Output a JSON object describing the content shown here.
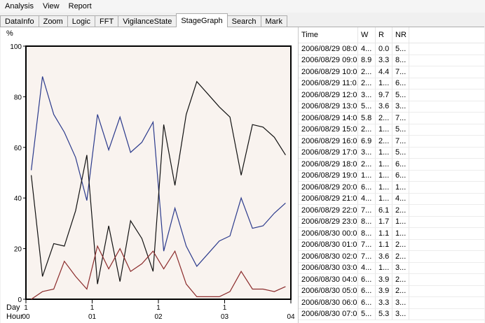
{
  "menu": [
    "Analysis",
    "View",
    "Report"
  ],
  "tabs": [
    {
      "label": "DataInfo",
      "active": false
    },
    {
      "label": "Zoom",
      "active": false
    },
    {
      "label": "Logic",
      "active": false
    },
    {
      "label": "FFT",
      "active": false
    },
    {
      "label": "VigilanceState",
      "active": false
    },
    {
      "label": "StageGraph",
      "active": true
    },
    {
      "label": "Search",
      "active": false
    },
    {
      "label": "Mark",
      "active": false
    }
  ],
  "chart_data": {
    "type": "line",
    "title": "",
    "ylabel": "%",
    "ylim": [
      0,
      100
    ],
    "yticks": [
      0,
      20,
      40,
      60,
      80,
      100
    ],
    "xlim": [
      0,
      4
    ],
    "xrow_labels": [
      "Day",
      "Hour"
    ],
    "xticks": [
      {
        "x": 0,
        "day": "1",
        "hour": "00"
      },
      {
        "x": 1,
        "day": "1",
        "hour": "01"
      },
      {
        "x": 2,
        "day": "1",
        "hour": "02"
      },
      {
        "x": 3,
        "day": "1",
        "hour": "03"
      },
      {
        "x": 4,
        "day": "",
        "hour": "04"
      }
    ],
    "series": [
      {
        "color": "#2b3a8c",
        "points": [
          [
            0.08,
            51
          ],
          [
            0.25,
            88
          ],
          [
            0.42,
            73
          ],
          [
            0.58,
            66
          ],
          [
            0.75,
            56
          ],
          [
            0.92,
            39
          ],
          [
            1.08,
            73
          ],
          [
            1.25,
            59
          ],
          [
            1.42,
            72
          ],
          [
            1.58,
            58
          ],
          [
            1.75,
            62
          ],
          [
            1.92,
            70
          ],
          [
            2.08,
            19
          ],
          [
            2.25,
            36
          ],
          [
            2.42,
            21
          ],
          [
            2.58,
            13
          ],
          [
            2.75,
            18
          ],
          [
            2.92,
            23
          ],
          [
            3.08,
            25
          ],
          [
            3.25,
            40
          ],
          [
            3.42,
            28
          ],
          [
            3.58,
            29
          ],
          [
            3.75,
            34
          ],
          [
            3.92,
            38
          ]
        ]
      },
      {
        "color": "#111111",
        "points": [
          [
            0.08,
            49
          ],
          [
            0.25,
            9
          ],
          [
            0.42,
            22
          ],
          [
            0.58,
            21
          ],
          [
            0.75,
            35
          ],
          [
            0.92,
            57
          ],
          [
            1.08,
            6
          ],
          [
            1.25,
            29
          ],
          [
            1.42,
            7
          ],
          [
            1.58,
            31
          ],
          [
            1.75,
            24
          ],
          [
            1.92,
            11
          ],
          [
            2.08,
            69
          ],
          [
            2.25,
            45
          ],
          [
            2.42,
            73
          ],
          [
            2.58,
            86
          ],
          [
            2.75,
            81
          ],
          [
            2.92,
            76
          ],
          [
            3.08,
            72
          ],
          [
            3.25,
            49
          ],
          [
            3.42,
            69
          ],
          [
            3.58,
            68
          ],
          [
            3.75,
            64
          ],
          [
            3.92,
            57
          ]
        ]
      },
      {
        "color": "#8b2b2b",
        "points": [
          [
            0.08,
            0
          ],
          [
            0.25,
            3
          ],
          [
            0.42,
            4
          ],
          [
            0.58,
            15
          ],
          [
            0.75,
            9
          ],
          [
            0.92,
            4
          ],
          [
            1.08,
            21
          ],
          [
            1.25,
            12
          ],
          [
            1.42,
            20
          ],
          [
            1.58,
            11
          ],
          [
            1.75,
            14
          ],
          [
            1.92,
            19
          ],
          [
            2.08,
            12
          ],
          [
            2.25,
            19
          ],
          [
            2.42,
            6
          ],
          [
            2.58,
            1
          ],
          [
            2.75,
            1
          ],
          [
            2.92,
            1
          ],
          [
            3.08,
            3
          ],
          [
            3.25,
            11
          ],
          [
            3.42,
            4
          ],
          [
            3.58,
            4
          ],
          [
            3.75,
            3
          ],
          [
            3.92,
            5
          ]
        ]
      }
    ]
  },
  "table": {
    "columns": [
      "Time",
      "W",
      "R",
      "NR",
      ""
    ],
    "rows": [
      [
        "2006/08/29 08:0...",
        "4...",
        "0.0",
        "5...",
        ""
      ],
      [
        "2006/08/29 09:0...",
        "8.9",
        "3.3",
        "8...",
        ""
      ],
      [
        "2006/08/29 10:0...",
        "2...",
        "4.4",
        "7...",
        ""
      ],
      [
        "2006/08/29 11:0...",
        "2...",
        "1...",
        "6...",
        ""
      ],
      [
        "2006/08/29 12:0...",
        "3...",
        "9.7",
        "5...",
        ""
      ],
      [
        "2006/08/29 13:0...",
        "5...",
        "3.6",
        "3...",
        ""
      ],
      [
        "2006/08/29 14:0...",
        "5.8",
        "2...",
        "7...",
        ""
      ],
      [
        "2006/08/29 15:0...",
        "2...",
        "1...",
        "5...",
        ""
      ],
      [
        "2006/08/29 16:0...",
        "6.9",
        "2...",
        "7...",
        ""
      ],
      [
        "2006/08/29 17:0...",
        "3...",
        "1...",
        "5...",
        ""
      ],
      [
        "2006/08/29 18:0...",
        "2...",
        "1...",
        "6...",
        ""
      ],
      [
        "2006/08/29 19:0...",
        "1...",
        "1...",
        "6...",
        ""
      ],
      [
        "2006/08/29 20:0...",
        "6...",
        "1...",
        "1...",
        ""
      ],
      [
        "2006/08/29 21:0...",
        "4...",
        "1...",
        "4...",
        ""
      ],
      [
        "2006/08/29 22:0...",
        "7...",
        "6.1",
        "2...",
        ""
      ],
      [
        "2006/08/29 23:0...",
        "8...",
        "1.7",
        "1...",
        ""
      ],
      [
        "2006/08/30 00:0...",
        "8...",
        "1.1",
        "1...",
        ""
      ],
      [
        "2006/08/30 01:0...",
        "7...",
        "1.1",
        "2...",
        ""
      ],
      [
        "2006/08/30 02:0...",
        "7...",
        "3.6",
        "2...",
        ""
      ],
      [
        "2006/08/30 03:0...",
        "4...",
        "1...",
        "3...",
        ""
      ],
      [
        "2006/08/30 04:0...",
        "6...",
        "3.9",
        "2...",
        ""
      ],
      [
        "2006/08/30 05:0...",
        "6...",
        "3.9",
        "2...",
        ""
      ],
      [
        "2006/08/30 06:0...",
        "6...",
        "3.3",
        "3...",
        ""
      ],
      [
        "2006/08/30 07:0...",
        "5...",
        "5.3",
        "3...",
        ""
      ]
    ]
  }
}
